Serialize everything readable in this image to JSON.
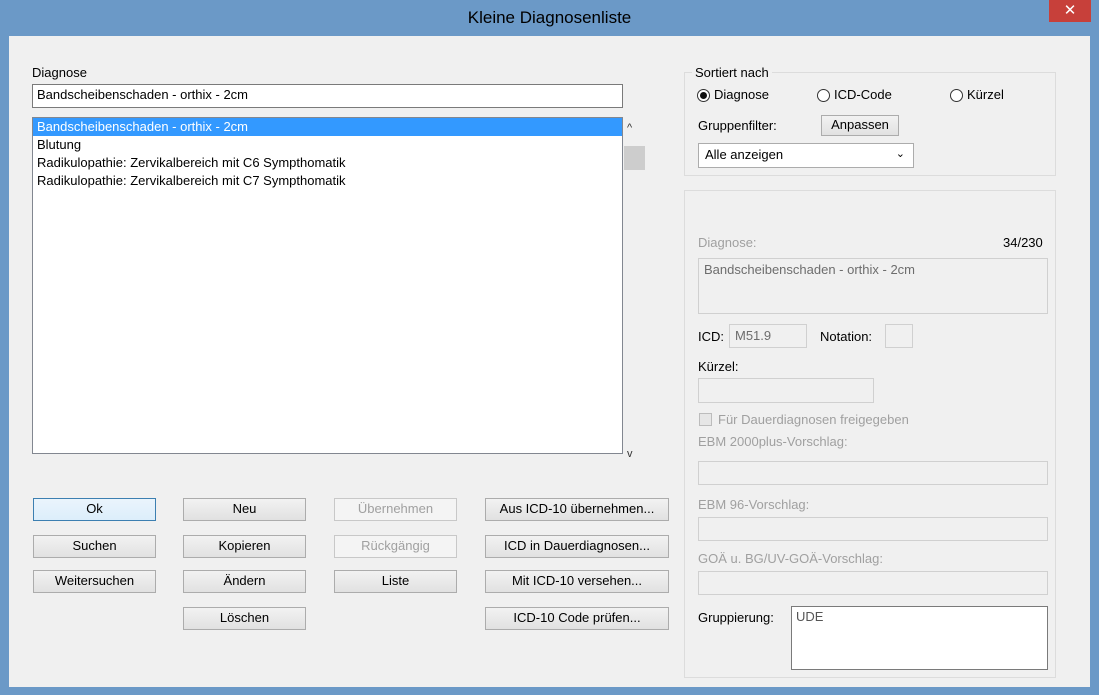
{
  "window": {
    "title": "Kleine Diagnosenliste",
    "close_glyph": "✕"
  },
  "diagnose": {
    "label": "Diagnose",
    "input_value": "Bandscheibenschaden - orthix - 2cm",
    "list": [
      "Bandscheibenschaden - orthix - 2cm",
      "Blutung",
      "Radikulopathie: Zervikalbereich mit C6 Sympthomatik",
      "Radikulopathie: Zervikalbereich mit C7 Sympthomatik"
    ],
    "selected_index": 0,
    "scroll_up": "ˆ",
    "scroll_down": "ˇ"
  },
  "buttons": {
    "ok": "Ok",
    "suchen": "Suchen",
    "weitersuchen": "Weitersuchen",
    "neu": "Neu",
    "kopieren": "Kopieren",
    "aendern": "Ändern",
    "loeschen": "Löschen",
    "uebernehmen": "Übernehmen",
    "rueckgaengig": "Rückgängig",
    "liste": "Liste",
    "aus_icd": "Aus ICD-10 übernehmen...",
    "icd_dauer": "ICD in Dauerdiagnosen...",
    "mit_icd": "Mit ICD-10 versehen...",
    "icd_pruefen": "ICD-10 Code prüfen..."
  },
  "sort": {
    "legend": "Sortiert nach",
    "options": [
      "Diagnose",
      "ICD-Code",
      "Kürzel"
    ],
    "selected": "Diagnose",
    "group_filter_label": "Gruppenfilter:",
    "anpassen": "Anpassen",
    "filter_value": "Alle anzeigen",
    "filter_arrow": "⌄"
  },
  "detail": {
    "diagnose_label": "Diagnose:",
    "counter": "34/230",
    "diagnose_value": "Bandscheibenschaden - orthix - 2cm",
    "icd_label": "ICD:",
    "icd_value": "M51.9",
    "notation_label": "Notation:",
    "notation_value": "",
    "kuerzel_label": "Kürzel:",
    "kuerzel_value": "",
    "dauer_checkbox": "Für Dauerdiagnosen freigegeben",
    "ebm2000_label": "EBM 2000plus-Vorschlag:",
    "ebm2000_value": "",
    "ebm96_label": "EBM 96-Vorschlag:",
    "ebm96_value": "",
    "goae_label": "GOÄ u. BG/UV-GOÄ-Vorschlag:",
    "goae_value": "",
    "gruppierung_label": "Gruppierung:",
    "gruppierung_value": "UDE"
  },
  "colors": {
    "titlebar": "#6b99c7",
    "close": "#c7403a",
    "selection": "#3399ff",
    "client": "#f0f0f0"
  }
}
